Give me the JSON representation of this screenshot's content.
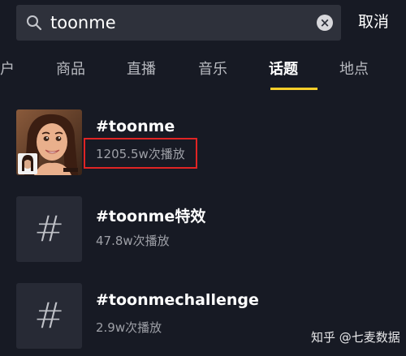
{
  "search": {
    "query": "toonme",
    "cancel_label": "取消"
  },
  "tabs": [
    {
      "label": "户"
    },
    {
      "label": "商品"
    },
    {
      "label": "直播"
    },
    {
      "label": "音乐"
    },
    {
      "label": "话题"
    },
    {
      "label": "地点"
    }
  ],
  "active_tab": "话题",
  "colors": {
    "accent": "#facf2a",
    "highlight": "#e02424",
    "background": "#171a24"
  },
  "results": [
    {
      "title": "#toonme",
      "views": "1205.5w次播放",
      "thumbnail": "cartoon-avatar-image"
    },
    {
      "title": "#toonme特效",
      "views": "47.8w次播放",
      "thumbnail": "hash-icon"
    },
    {
      "title": "#toonmechallenge",
      "views": "2.9w次播放",
      "thumbnail": "hash-icon"
    }
  ],
  "watermark": "知乎 @七麦数据"
}
